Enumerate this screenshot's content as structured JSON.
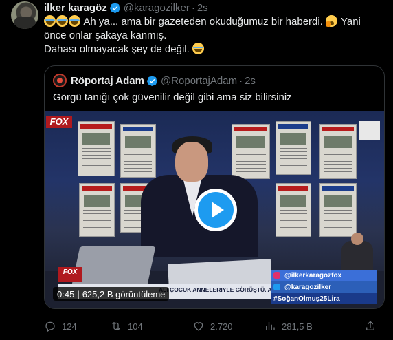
{
  "author": {
    "name": "ilker karagöz",
    "handle": "@karagozilker",
    "time": "2s"
  },
  "tweet": {
    "line1": "Ah ya... ama bir gazeteden okuduğumuz bir haberdi.",
    "line1b": "Yani",
    "line2": "önce onlar şakaya kanmış.",
    "line3": "Dahası olmayacak şey de değil."
  },
  "quoted": {
    "name": "Röportaj Adam",
    "handle": "@RoportajAdam",
    "time": "2s",
    "text": "Görgü tanığı çok güvenilir değil gibi ama siz bilirsiniz"
  },
  "video": {
    "duration": "0:45",
    "views": "625,2 B görüntüleme",
    "fox_label": "FOX",
    "fox_lower": "FOX",
    "ticker": "ALI ÇOCUK ANNELERIYLE GÖRÜŞTÜ. ANNE:",
    "social": [
      "@ilkerkaragozfox",
      "@karagozilker",
      "#SoğanOlmuş25Lira"
    ]
  },
  "actions": {
    "replies": "124",
    "retweets": "104",
    "likes": "2.720",
    "views": "281,5 B"
  },
  "colors": {
    "accent": "#1d9bf0",
    "muted": "#71767b",
    "border": "#2f3336"
  }
}
